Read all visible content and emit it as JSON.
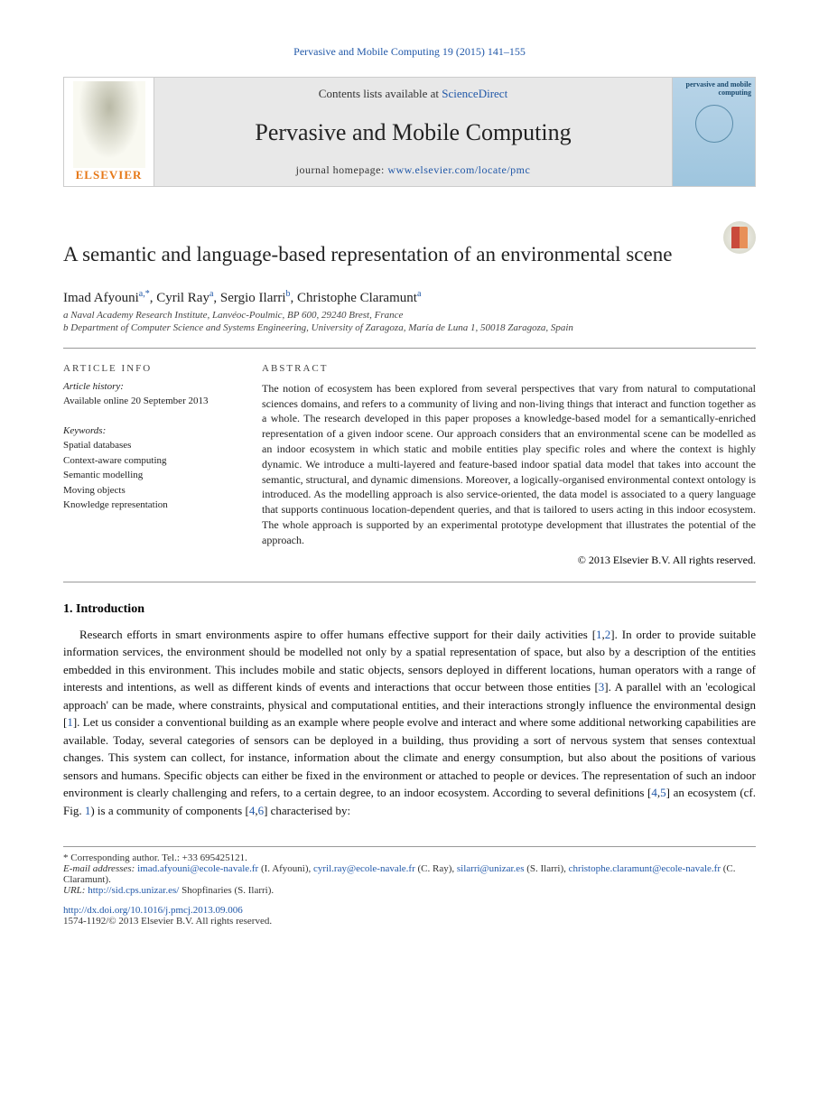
{
  "journal_ref": "Pervasive and Mobile Computing 19 (2015) 141–155",
  "header": {
    "publisher": "ELSEVIER",
    "contents_prefix": "Contents lists available at ",
    "contents_link": "ScienceDirect",
    "journal_name": "Pervasive and Mobile Computing",
    "homepage_prefix": "journal homepage: ",
    "homepage_url": "www.elsevier.com/locate/pmc",
    "cover_title": "pervasive and mobile computing"
  },
  "title": "A semantic and language-based representation of an environmental scene",
  "authors_line": "Imad Afyouni a,*, Cyril Ray a, Sergio Ilarri b, Christophe Claramunt a",
  "authors": [
    {
      "name": "Imad Afyouni",
      "sup": "a,*"
    },
    {
      "name": "Cyril Ray",
      "sup": "a"
    },
    {
      "name": "Sergio Ilarri",
      "sup": "b"
    },
    {
      "name": "Christophe Claramunt",
      "sup": "a"
    }
  ],
  "affiliations": [
    "a Naval Academy Research Institute, Lanvéoc-Poulmic, BP 600, 29240 Brest, France",
    "b Department of Computer Science and Systems Engineering, University of Zaragoza, María de Luna 1, 50018 Zaragoza, Spain"
  ],
  "article_info": {
    "head": "ARTICLE INFO",
    "history_label": "Article history:",
    "history": "Available online 20 September 2013",
    "keywords_label": "Keywords:",
    "keywords": [
      "Spatial databases",
      "Context-aware computing",
      "Semantic modelling",
      "Moving objects",
      "Knowledge representation"
    ]
  },
  "abstract": {
    "head": "ABSTRACT",
    "text": "The notion of ecosystem has been explored from several perspectives that vary from natural to computational sciences domains, and refers to a community of living and non-living things that interact and function together as a whole. The research developed in this paper proposes a knowledge-based model for a semantically-enriched representation of a given indoor scene. Our approach considers that an environmental scene can be modelled as an indoor ecosystem in which static and mobile entities play specific roles and where the context is highly dynamic. We introduce a multi-layered and feature-based indoor spatial data model that takes into account the semantic, structural, and dynamic dimensions. Moreover, a logically-organised environmental context ontology is introduced. As the modelling approach is also service-oriented, the data model is associated to a query language that supports continuous location-dependent queries, and that is tailored to users acting in this indoor ecosystem. The whole approach is supported by an experimental prototype development that illustrates the potential of the approach.",
    "copyright": "© 2013 Elsevier B.V. All rights reserved."
  },
  "section": {
    "num": "1.",
    "title": "Introduction"
  },
  "body": {
    "p1_a": "Research efforts in smart environments aspire to offer humans effective support for their daily activities [",
    "c1": "1",
    "p1_b": ",",
    "c2": "2",
    "p1_c": "]. In order to provide suitable information services, the environment should be modelled not only by a spatial representation of space, but also by a description of the entities embedded in this environment. This includes mobile and static objects, sensors deployed in different locations, human operators with a range of interests and intentions, as well as different kinds of events and interactions that occur between those entities [",
    "c3": "3",
    "p1_d": "]. A parallel with an 'ecological approach' can be made, where constraints, physical and computational entities, and their interactions strongly influence the environmental design [",
    "c4": "1",
    "p1_e": "]. Let us consider a conventional building as an example where people evolve and interact and where some additional networking capabilities are available. Today, several categories of sensors can be deployed in a building, thus providing a sort of nervous system that senses contextual changes. This system can collect, for instance, information about the climate and energy consumption, but also about the positions of various sensors and humans. Specific objects can either be fixed in the environment or attached to people or devices. The representation of such an indoor environment is clearly challenging and refers, to a certain degree, to an indoor ecosystem. According to several definitions [",
    "c5": "4",
    "p1_f": ",",
    "c6": "5",
    "p1_g": "] an ecosystem (cf. Fig. ",
    "c7": "1",
    "p1_h": ") is a community of components [",
    "c8": "4",
    "p1_i": ",",
    "c9": "6",
    "p1_j": "] characterised by:"
  },
  "footnotes": {
    "corresponding": "* Corresponding author. Tel.: +33 695425121.",
    "emails_label": "E-mail addresses:",
    "emails": [
      {
        "addr": "imad.afyouni@ecole-navale.fr",
        "who": "(I. Afyouni)"
      },
      {
        "addr": "cyril.ray@ecole-navale.fr",
        "who": "(C. Ray)"
      },
      {
        "addr": "silarri@unizar.es",
        "who": "(S. Ilarri)"
      },
      {
        "addr": "christophe.claramunt@ecole-navale.fr",
        "who": "(C. Claramunt)"
      }
    ],
    "url_label": "URL:",
    "url": "http://sid.cps.unizar.es/",
    "url_who": "Shopfinaries",
    "url_who2": "(S. Ilarri)."
  },
  "doi": "http://dx.doi.org/10.1016/j.pmcj.2013.09.006",
  "issn": "1574-1192/© 2013 Elsevier B.V. All rights reserved."
}
